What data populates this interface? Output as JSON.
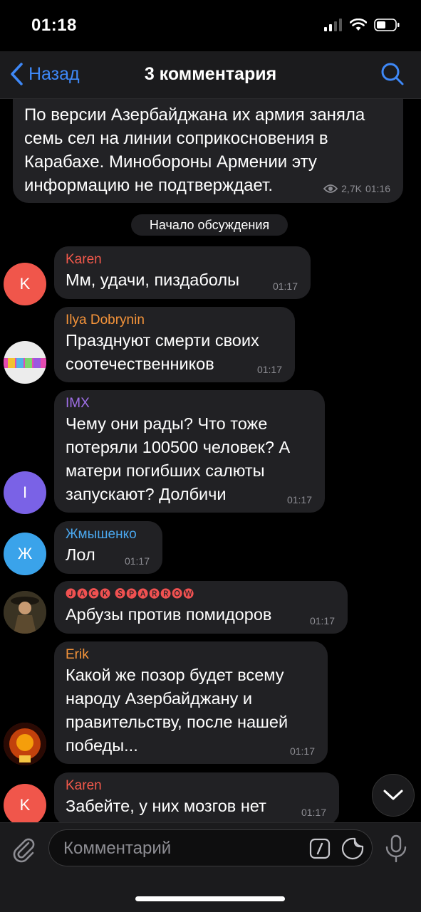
{
  "status_bar": {
    "time": "01:18"
  },
  "nav": {
    "back_label": "Назад",
    "title": "3 комментария"
  },
  "post": {
    "text": "По версии Азербайджана их армия заняла семь сел на линии соприкосновения в Карабахе. Минобороны Армении эту информацию не подтверждает.",
    "views": "2,7K",
    "time": "01:16"
  },
  "divider": "Начало обсуждения",
  "messages": [
    {
      "author": "Karen",
      "author_color": "#f2594b",
      "avatar_letter": "K",
      "avatar_color": "#f0564b",
      "text": "Мм, удачи, пиздаболы",
      "time": "01:17"
    },
    {
      "author": "Ilya Dobrynin",
      "author_color": "#f5943a",
      "avatar_letter": "",
      "avatar_color": "#e9e9e9",
      "text": "Празднуют смерти своих соотечественников",
      "time": "01:17"
    },
    {
      "author": "IMX",
      "author_color": "#9f6fe6",
      "avatar_letter": "I",
      "avatar_color": "#7a62e6",
      "text": "Чему они рады? Что тоже потеряли 100500 человек? А матери погибших салюты запускают? Долбичи",
      "time": "01:17"
    },
    {
      "author": "Жмышенко",
      "author_color": "#4aa7ee",
      "avatar_letter": "Ж",
      "avatar_color": "#3aa3ea",
      "text": "Лол",
      "time": "01:17"
    },
    {
      "author": "🅙🅐🅒🅚 🅢🅟🅐🅡🅡🅞🅦",
      "author_color": "#f05151",
      "avatar_letter": "",
      "avatar_color": "#2c2a22",
      "text": "Арбузы против помидоров",
      "time": "01:17"
    },
    {
      "author": "Erik",
      "author_color": "#f5943a",
      "avatar_letter": "",
      "avatar_color": "#7a1f0c",
      "text": "Какой же позор будет всему народу Азербайджану и правительству,  после нашей победы...",
      "time": "01:17"
    },
    {
      "author": "Karen",
      "author_color": "#f2594b",
      "avatar_letter": "K",
      "avatar_color": "#f0564b",
      "text": "Забейте, у них мозгов нет",
      "time": "01:17"
    }
  ],
  "input": {
    "placeholder": "Комментарий"
  },
  "icons": {
    "back": "chevron-left-icon",
    "search": "search-icon",
    "attach": "paperclip-icon",
    "commands": "slash-command-icon",
    "sticker": "sticker-icon",
    "mic": "microphone-icon",
    "scroll_down": "chevron-down-icon"
  },
  "colors": {
    "accent": "#3e88f7",
    "bubble": "#212124",
    "background": "#000000",
    "meta": "#8d8d93"
  }
}
